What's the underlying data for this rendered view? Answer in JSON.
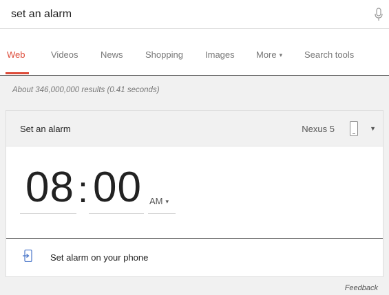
{
  "search": {
    "value": "set an alarm"
  },
  "tabs": [
    {
      "label": "Web",
      "active": true
    },
    {
      "label": "Videos",
      "active": false
    },
    {
      "label": "News",
      "active": false
    },
    {
      "label": "Shopping",
      "active": false
    },
    {
      "label": "Images",
      "active": false
    },
    {
      "label": "More",
      "active": false,
      "caret": true
    },
    {
      "label": "Search tools",
      "active": false
    }
  ],
  "results_count": "About 346,000,000 results (0.41 seconds)",
  "alarm_card": {
    "title": "Set an alarm",
    "device": "Nexus 5",
    "hours": "08",
    "separator": ":",
    "minutes": "00",
    "ampm": "AM",
    "action_label": "Set alarm on your phone"
  },
  "footer": {
    "feedback": "Feedback"
  },
  "colors": {
    "accent": "#dd4b39",
    "muted_text": "#777777",
    "background": "#f1f1f1"
  }
}
